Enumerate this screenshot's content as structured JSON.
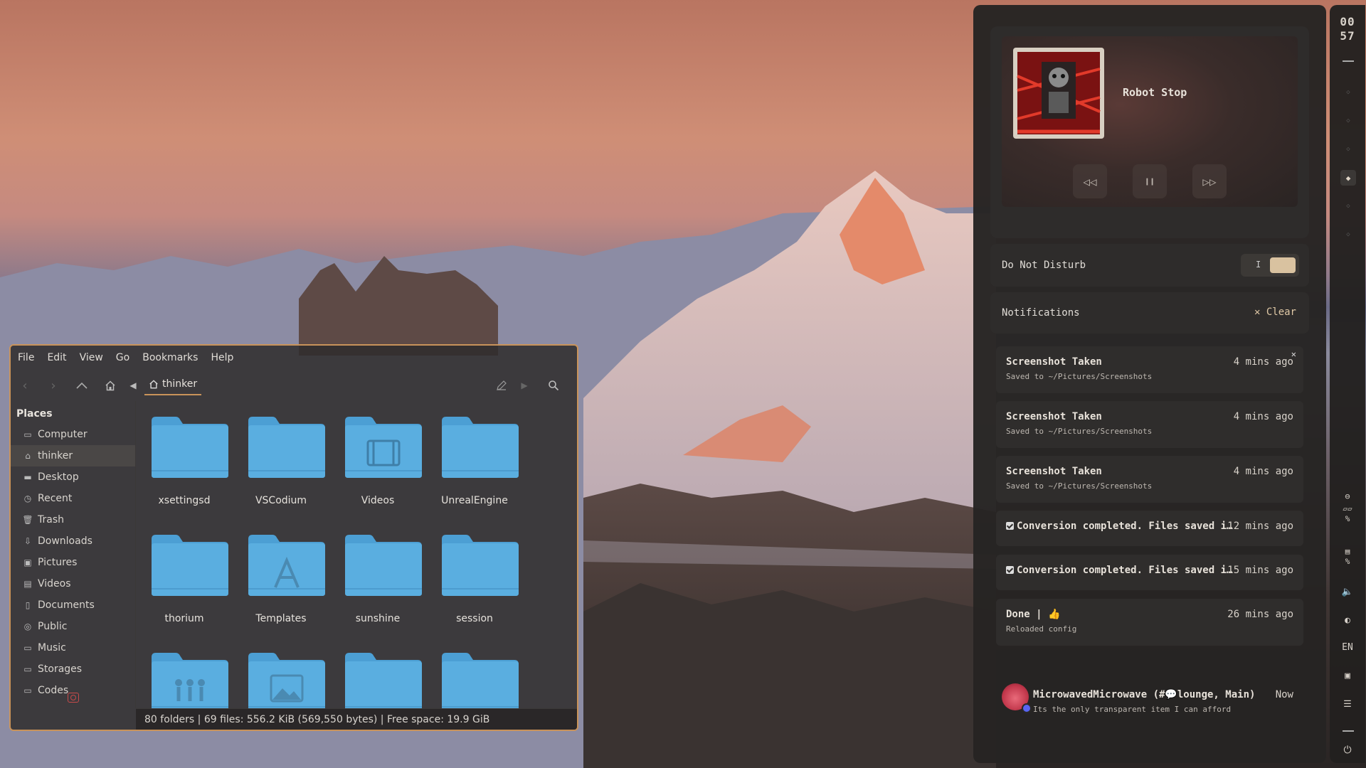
{
  "file_manager": {
    "menu": [
      "File",
      "Edit",
      "View",
      "Go",
      "Bookmarks",
      "Help"
    ],
    "path": "thinker",
    "places_title": "Places",
    "places": [
      {
        "label": "Computer",
        "icon": "computer-icon"
      },
      {
        "label": "thinker",
        "icon": "home-icon"
      },
      {
        "label": "Desktop",
        "icon": "desktop-icon"
      },
      {
        "label": "Recent",
        "icon": "clock-icon"
      },
      {
        "label": "Trash",
        "icon": "trash-icon"
      },
      {
        "label": "Downloads",
        "icon": "download-icon"
      },
      {
        "label": "Pictures",
        "icon": "image-icon"
      },
      {
        "label": "Videos",
        "icon": "film-icon"
      },
      {
        "label": "Documents",
        "icon": "document-icon"
      },
      {
        "label": "Public",
        "icon": "share-icon"
      },
      {
        "label": "Music",
        "icon": "folder-icon"
      },
      {
        "label": "Storages",
        "icon": "folder-icon"
      },
      {
        "label": "Codes",
        "icon": "folder-icon"
      }
    ],
    "folders": [
      {
        "name": "xsettingsd",
        "emblem": ""
      },
      {
        "name": "VSCodium",
        "emblem": ""
      },
      {
        "name": "Videos",
        "emblem": "film"
      },
      {
        "name": "UnrealEngine",
        "emblem": ""
      },
      {
        "name": "thorium",
        "emblem": ""
      },
      {
        "name": "Templates",
        "emblem": "templates"
      },
      {
        "name": "sunshine",
        "emblem": ""
      },
      {
        "name": "session",
        "emblem": ""
      },
      {
        "name": "",
        "emblem": "people"
      },
      {
        "name": "",
        "emblem": "image"
      },
      {
        "name": "",
        "emblem": ""
      },
      {
        "name": "",
        "emblem": ""
      }
    ],
    "status": "80 folders  |  69 files: 556.2  KiB (569,550 bytes)  |  Free space: 19.9  GiB"
  },
  "panel": {
    "media": {
      "track": "Robot Stop"
    },
    "dnd_label": "Do Not Disturb",
    "dnd_toggle": "I",
    "notifications_label": "Notifications",
    "clear_label": "✕ Clear",
    "notifications": [
      {
        "title": "Screenshot Taken",
        "body": "Saved to ~/Pictures/Screenshots",
        "time": "4 mins ago",
        "checkbox": false
      },
      {
        "title": "Screenshot Taken",
        "body": "Saved to ~/Pictures/Screenshots",
        "time": "4 mins ago",
        "checkbox": false
      },
      {
        "title": "Screenshot Taken",
        "body": "Saved to ~/Pictures/Screenshots",
        "time": "4 mins ago",
        "checkbox": false
      },
      {
        "title": "Conversion completed. Files saved i…",
        "body": "",
        "time": "12 mins ago",
        "checkbox": true
      },
      {
        "title": "Conversion completed. Files saved i…",
        "body": "",
        "time": "15 mins ago",
        "checkbox": true
      },
      {
        "title": "Done | 👍",
        "body": "Reloaded config",
        "time": "26 mins ago",
        "checkbox": false
      }
    ],
    "discord": {
      "title": "MicrowavedMicrowave (#💬lounge, Main)",
      "body": "Its the only transparent item I can afford",
      "time": "Now"
    }
  },
  "bar": {
    "clock_line1": "00",
    "clock_line2": "57",
    "lang": "EN"
  },
  "colors": {
    "accent": "#c9935a",
    "panel_bg": "#262423",
    "folder_blue": "#5aaee0"
  }
}
